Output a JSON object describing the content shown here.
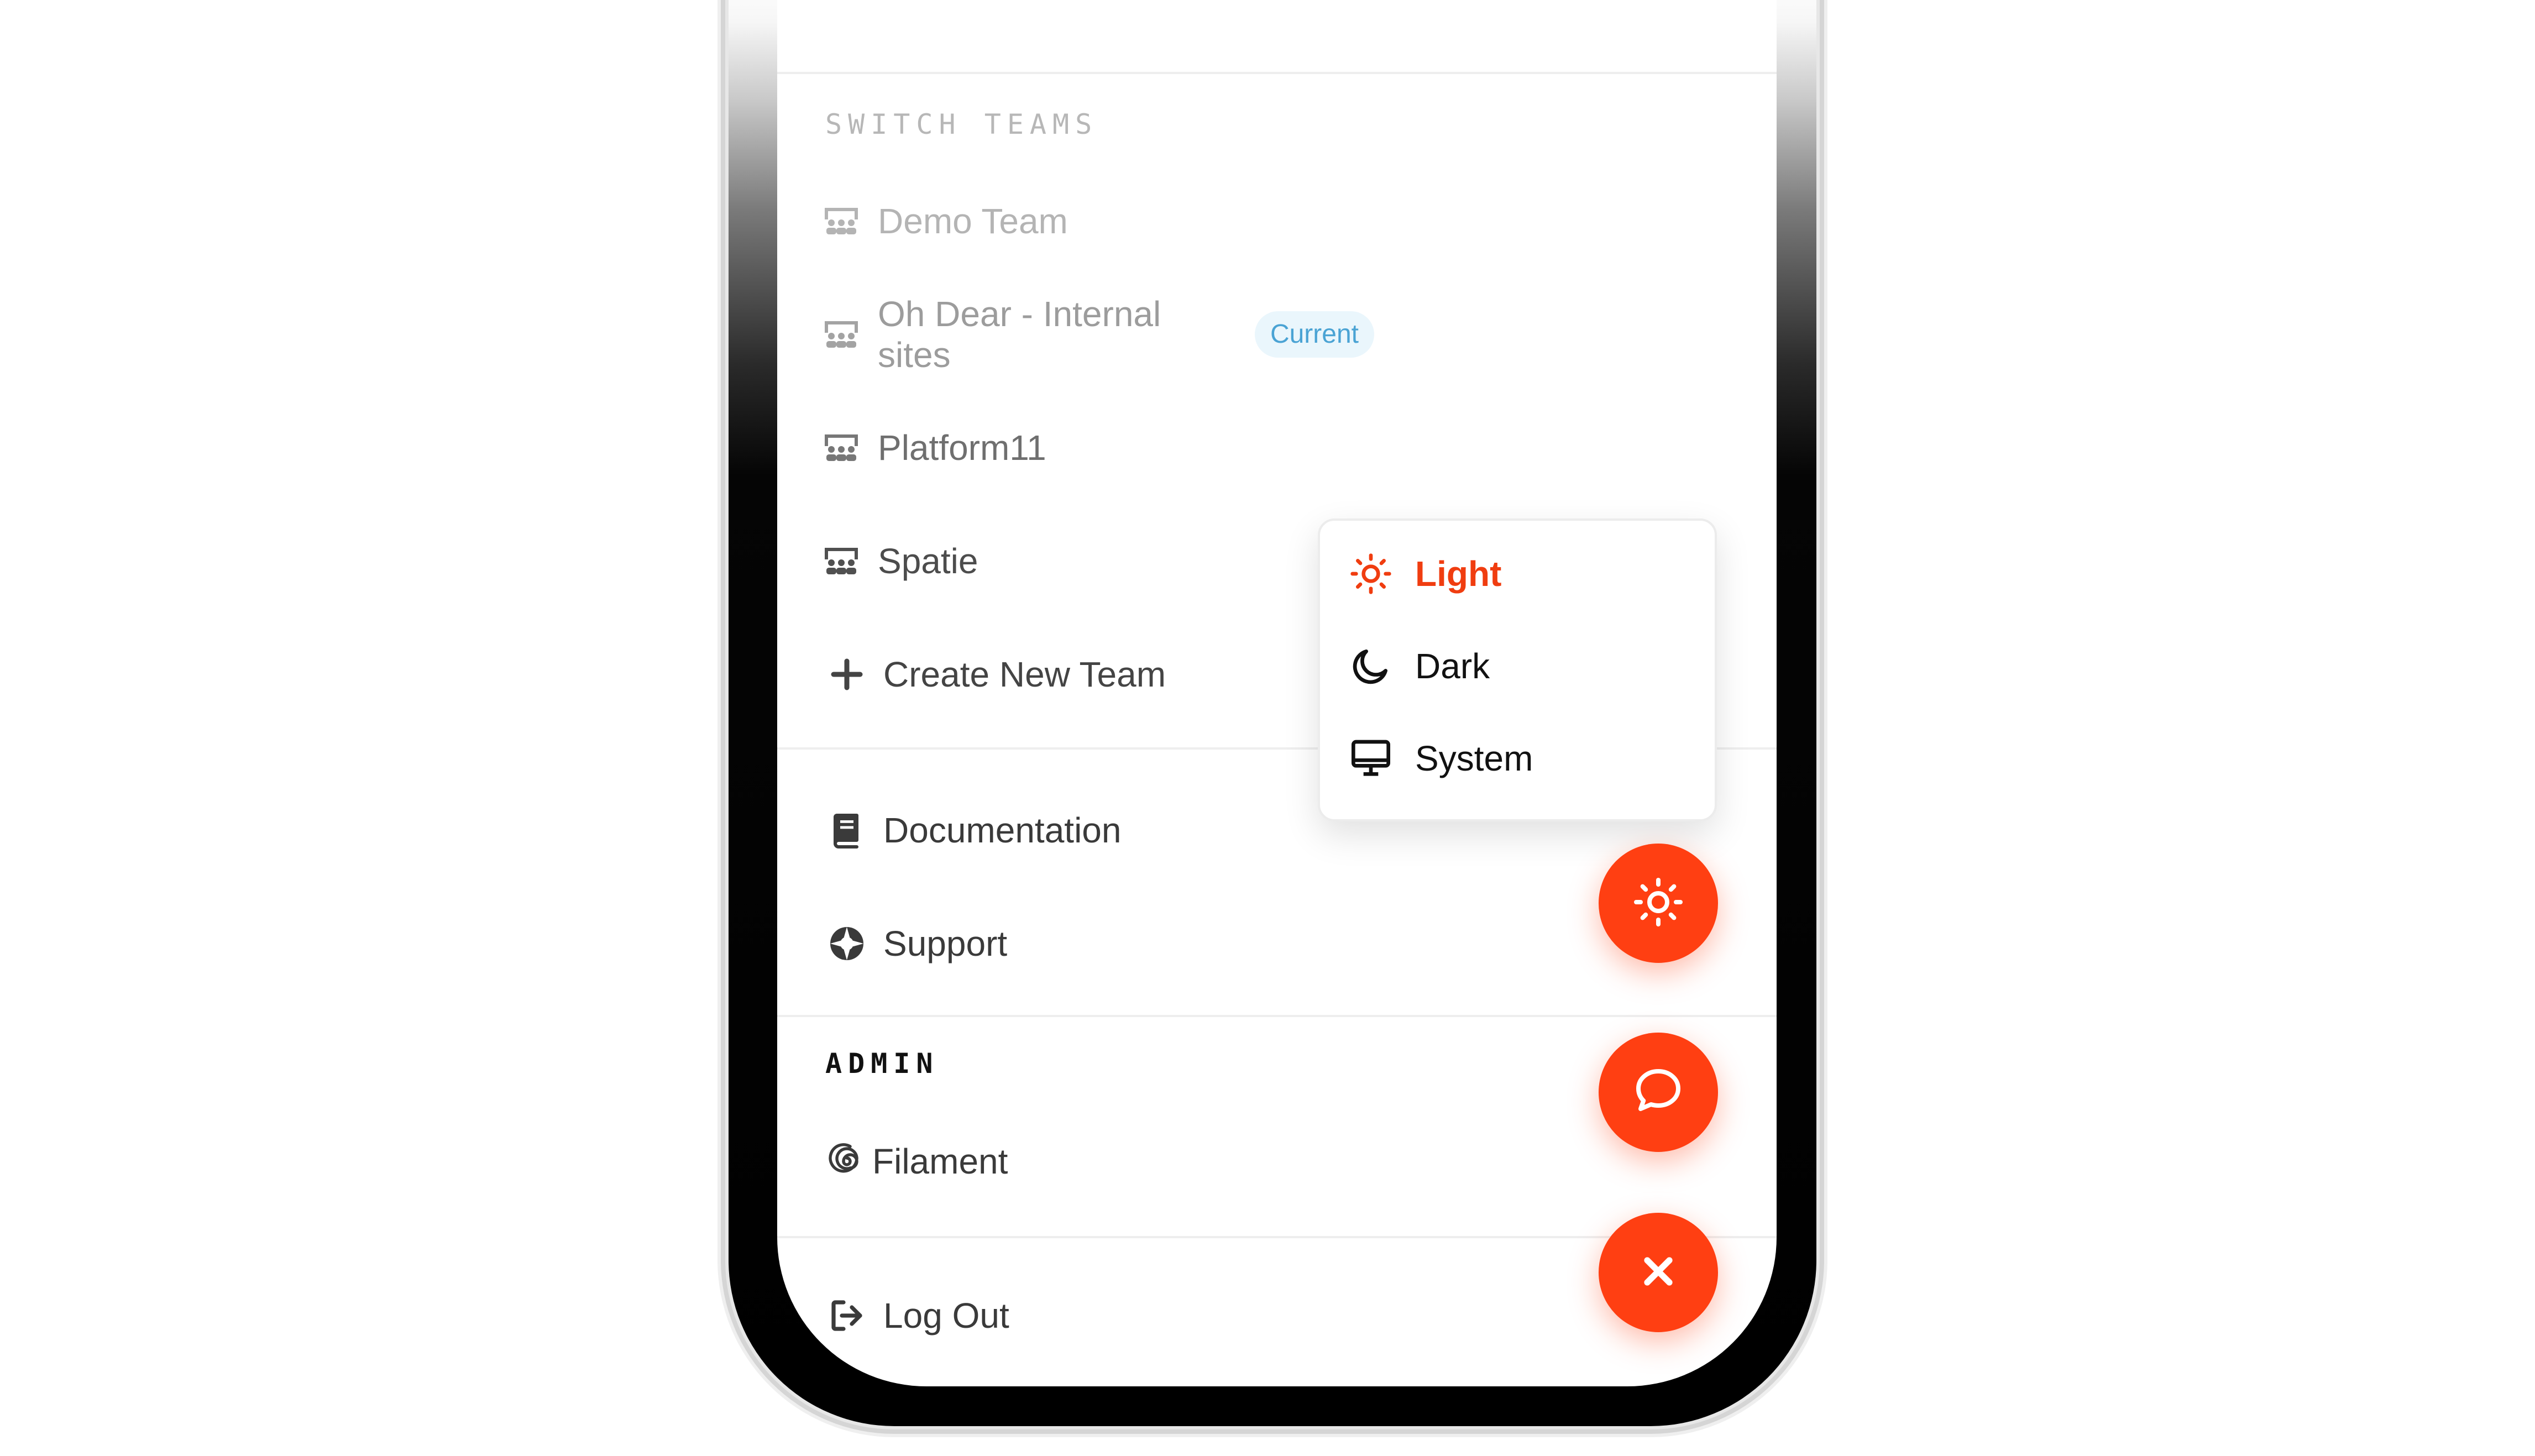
{
  "colors": {
    "accent": "#ff3f12",
    "light_text": "#b7b7b7",
    "badge_bg": "#eaf6fc",
    "badge_text": "#4aa3d4"
  },
  "switch_teams": {
    "title": "SWITCH TEAMS",
    "teams": [
      {
        "label": "Demo Team",
        "icon": "team-icon"
      },
      {
        "label": "Oh Dear - Internal sites",
        "icon": "team-icon",
        "badge": "Current"
      },
      {
        "label": "Platform11",
        "icon": "team-icon"
      },
      {
        "label": "Spatie",
        "icon": "team-icon"
      }
    ],
    "create_label": "Create New Team",
    "create_icon": "plus-icon"
  },
  "resources": {
    "items": [
      {
        "label": "Documentation",
        "icon": "book-icon"
      },
      {
        "label": "Support",
        "icon": "lifebuoy-icon"
      }
    ]
  },
  "admin": {
    "title": "ADMIN",
    "filament_label": "Filament",
    "filament_icon": "filament-logo-icon"
  },
  "logout": {
    "label": "Log Out",
    "icon": "logout-icon"
  },
  "theme_menu": {
    "options": [
      {
        "label": "Light",
        "icon": "sun-icon",
        "selected": true
      },
      {
        "label": "Dark",
        "icon": "moon-icon",
        "selected": false
      },
      {
        "label": "System",
        "icon": "monitor-icon",
        "selected": false
      }
    ]
  },
  "fabs": [
    {
      "icon": "sun-icon"
    },
    {
      "icon": "chat-bubble-icon"
    },
    {
      "icon": "close-icon"
    }
  ]
}
